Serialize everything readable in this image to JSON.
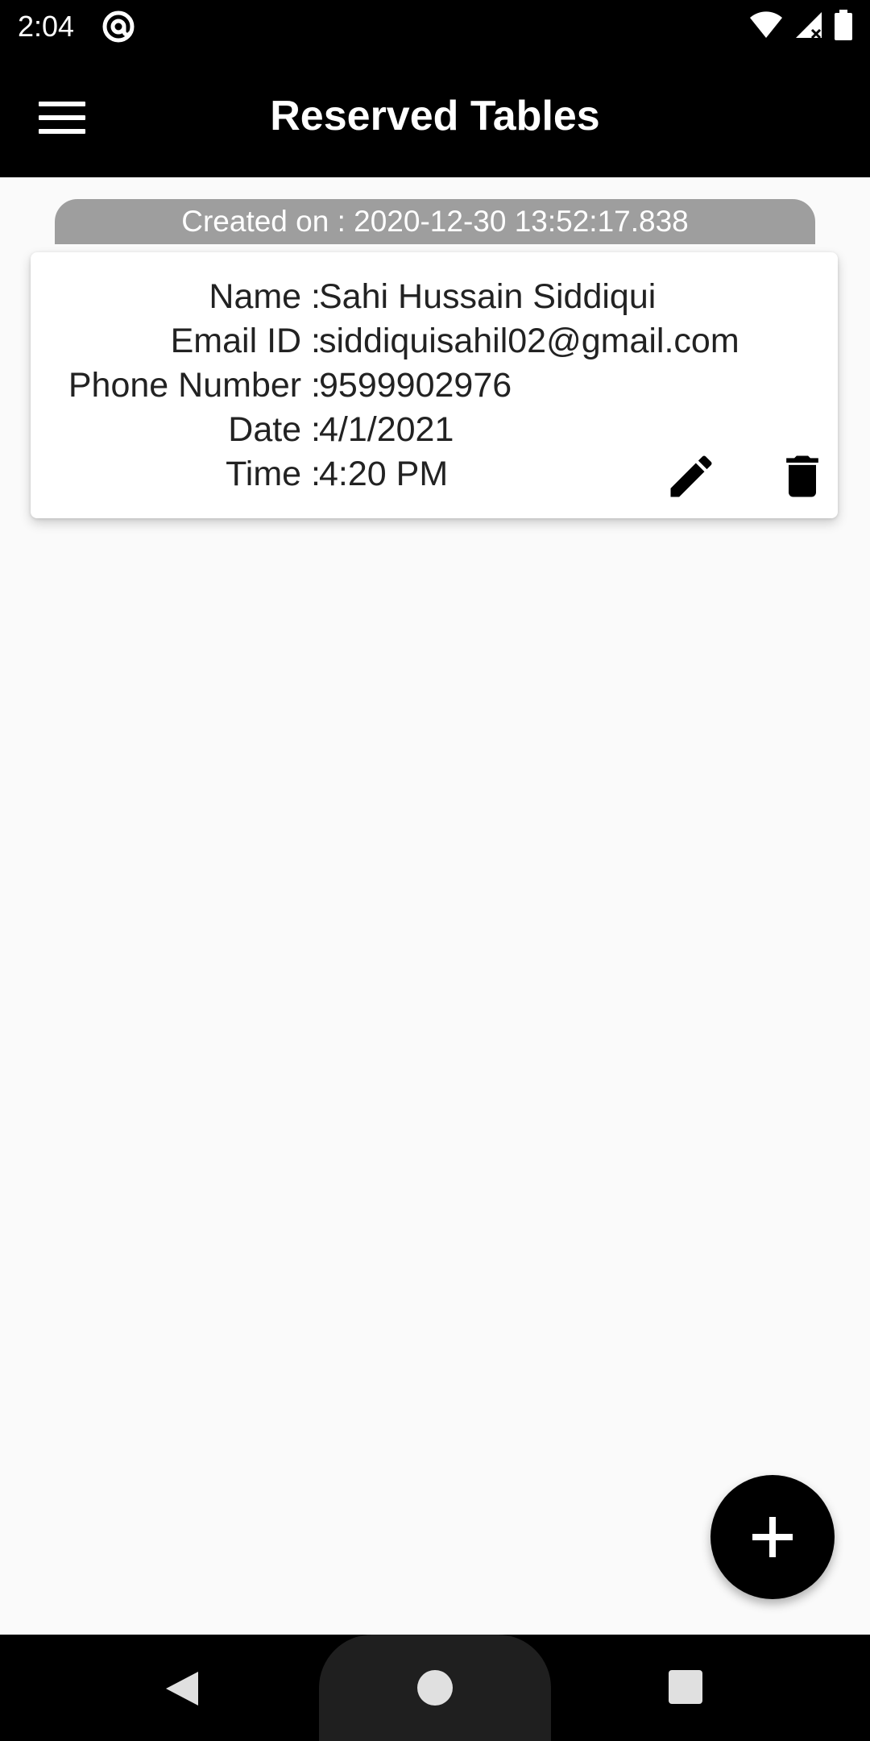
{
  "status_bar": {
    "time": "2:04"
  },
  "app_bar": {
    "title": "Reserved Tables"
  },
  "reservation": {
    "created_on": "Created on : 2020-12-30 13:52:17.838",
    "fields": [
      {
        "label": "Name :",
        "value": "Sahi Hussain Siddiqui"
      },
      {
        "label": "Email ID :",
        "value": "siddiquisahil02@gmail.com"
      },
      {
        "label": "Phone Number :",
        "value": "9599902976"
      },
      {
        "label": "Date :",
        "value": "4/1/2021"
      },
      {
        "label": "Time :",
        "value": "4:20 PM"
      }
    ]
  },
  "icons": {
    "menu": "hamburger-menu-icon",
    "edit": "pencil-icon",
    "delete": "trash-icon",
    "add": "plus-icon",
    "at": "at-sign-icon",
    "wifi": "wifi-icon",
    "signal": "signal-icon",
    "battery": "battery-icon"
  },
  "colors": {
    "app_bar": "#000000",
    "background": "#fafafa",
    "created_tab": "#9e9e9e",
    "fab": "#000000"
  }
}
